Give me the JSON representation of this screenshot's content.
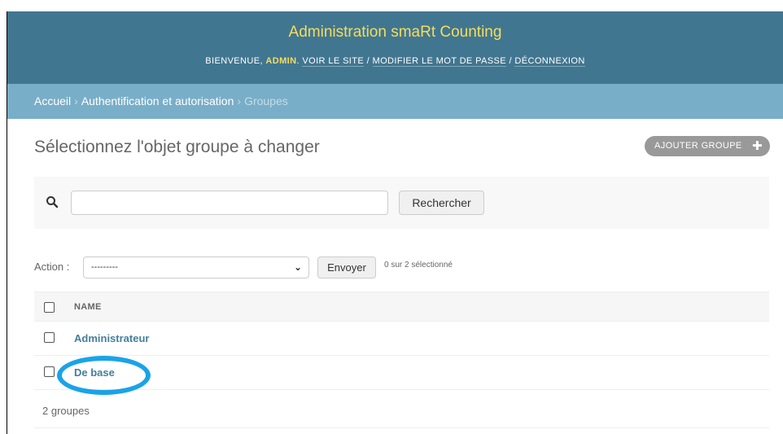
{
  "header": {
    "site_title": "Administration smaRt Counting",
    "welcome": "BIENVENUE,",
    "username": "ADMIN",
    "view_site": "VOIR LE SITE",
    "change_password": "MODIFIER LE MOT DE PASSE",
    "logout": "DÉCONNEXION",
    "separator": "/"
  },
  "breadcrumbs": {
    "home": "Accueil",
    "app": "Authentification et autorisation",
    "current": "Groupes",
    "separator": "›"
  },
  "page": {
    "title": "Sélectionnez l'objet groupe à changer",
    "add_button": "AJOUTER GROUPE",
    "add_icon": "plus-icon"
  },
  "search": {
    "value": "",
    "placeholder": "",
    "button": "Rechercher",
    "icon": "search-icon"
  },
  "actions": {
    "label": "Action :",
    "selected": "---------",
    "submit": "Envoyer",
    "selection_count": "0 sur 2 sélectionné"
  },
  "table": {
    "column": "NAME",
    "rows": [
      {
        "name": "Administrateur",
        "checked": false
      },
      {
        "name": "De base",
        "checked": false
      }
    ]
  },
  "result_count": "2 groupes",
  "annotation": {
    "highlight_color": "#1aa3e8"
  },
  "colors": {
    "header_bg": "#417690",
    "breadcrumb_bg": "#79aec8",
    "brand_text": "#f5dd5d",
    "link": "#447e9b"
  }
}
